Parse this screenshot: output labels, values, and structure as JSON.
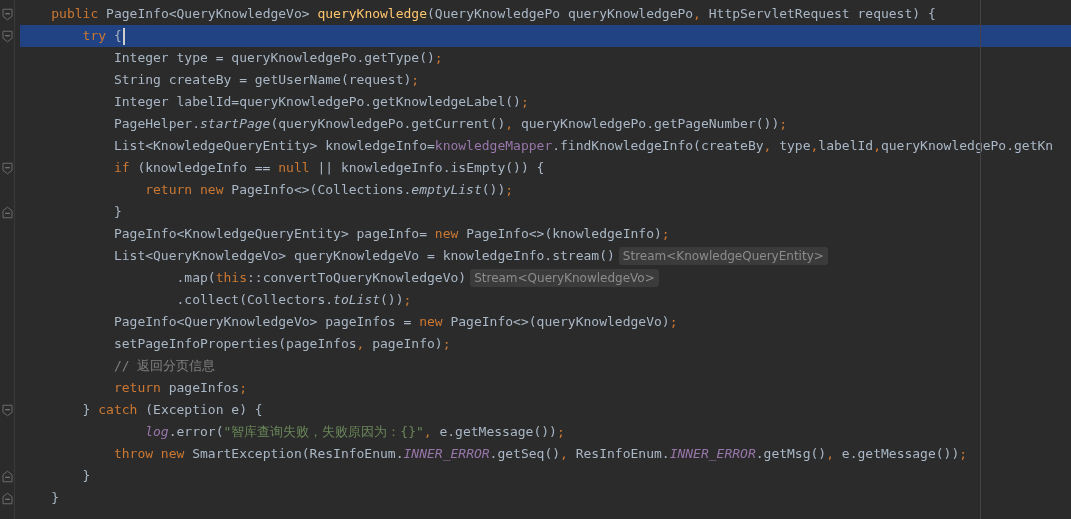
{
  "editor": {
    "lines": [
      {
        "selected": false,
        "fold_open": true,
        "tokens": [
          {
            "kind": "keyword",
            "text": "public "
          },
          {
            "kind": "plain",
            "text": "PageInfo<QueryKnowledgeVo> "
          },
          {
            "kind": "decl",
            "text": "queryKnowledge"
          },
          {
            "kind": "plain",
            "text": "(QueryKnowledgePo queryKnowledgePo"
          },
          {
            "kind": "punct",
            "text": ", "
          },
          {
            "kind": "plain",
            "text": "HttpServletRequest request) {"
          }
        ],
        "children": [
          {
            "selected": true,
            "fold_open": true,
            "tokens": [
              {
                "kind": "keyword",
                "text": "try "
              },
              {
                "kind": "plain",
                "text": "{"
              }
            ],
            "children": [
              {
                "selected": false,
                "tokens": [
                  {
                    "kind": "plain",
                    "text": "Integer type = queryKnowledgePo.getType()"
                  },
                  {
                    "kind": "punct",
                    "text": ";"
                  }
                ]
              },
              {
                "selected": false,
                "tokens": [
                  {
                    "kind": "plain",
                    "text": "String createBy = getUserName(request)"
                  },
                  {
                    "kind": "punct",
                    "text": ";"
                  }
                ]
              },
              {
                "selected": false,
                "tokens": [
                  {
                    "kind": "plain",
                    "text": "Integer labelId=queryKnowledgePo.getKnowledgeLabel()"
                  },
                  {
                    "kind": "punct",
                    "text": ";"
                  }
                ]
              },
              {
                "selected": false,
                "tokens": [
                  {
                    "kind": "plain",
                    "text": "PageHelper."
                  },
                  {
                    "kind": "static",
                    "text": "startPage"
                  },
                  {
                    "kind": "plain",
                    "text": "(queryKnowledgePo.getCurrent()"
                  },
                  {
                    "kind": "punct",
                    "text": ", "
                  },
                  {
                    "kind": "plain",
                    "text": "queryKnowledgePo.getPageNumber())"
                  },
                  {
                    "kind": "punct",
                    "text": ";"
                  }
                ]
              },
              {
                "selected": false,
                "tokens": [
                  {
                    "kind": "plain",
                    "text": "List<KnowledgeQueryEntity> knowledgeInfo="
                  },
                  {
                    "kind": "field",
                    "text": "knowledgeMapper"
                  },
                  {
                    "kind": "plain",
                    "text": ".findKnowledgeInfo(createBy"
                  },
                  {
                    "kind": "punct",
                    "text": ", "
                  },
                  {
                    "kind": "plain",
                    "text": "type"
                  },
                  {
                    "kind": "punct",
                    "text": ","
                  },
                  {
                    "kind": "plain",
                    "text": "labelId"
                  },
                  {
                    "kind": "punct",
                    "text": ","
                  },
                  {
                    "kind": "plain",
                    "text": "queryKnowledgePo.getKn"
                  }
                ]
              },
              {
                "selected": false,
                "fold_open": true,
                "tokens": [
                  {
                    "kind": "keyword",
                    "text": "if "
                  },
                  {
                    "kind": "plain",
                    "text": "(knowledgeInfo == "
                  },
                  {
                    "kind": "keyword",
                    "text": "null"
                  },
                  {
                    "kind": "plain",
                    "text": " || knowledgeInfo.isEmpty()) {"
                  }
                ],
                "children": [
                  {
                    "selected": false,
                    "tokens": [
                      {
                        "kind": "keyword",
                        "text": "return new "
                      },
                      {
                        "kind": "plain",
                        "text": "PageInfo<>(Collections."
                      },
                      {
                        "kind": "static",
                        "text": "emptyList"
                      },
                      {
                        "kind": "plain",
                        "text": "())"
                      },
                      {
                        "kind": "punct",
                        "text": ";"
                      }
                    ]
                  }
                ]
              },
              {
                "selected": false,
                "fold_close": true,
                "tokens": [
                  {
                    "kind": "plain",
                    "text": "}"
                  }
                ]
              },
              {
                "selected": false,
                "tokens": [
                  {
                    "kind": "plain",
                    "text": "PageInfo<KnowledgeQueryEntity> pageInfo= "
                  },
                  {
                    "kind": "keyword",
                    "text": "new "
                  },
                  {
                    "kind": "plain",
                    "text": "PageInfo<>(knowledgeInfo)"
                  },
                  {
                    "kind": "punct",
                    "text": ";"
                  }
                ]
              },
              {
                "selected": false,
                "hint": "Stream<KnowledgeQueryEntity>",
                "tokens": [
                  {
                    "kind": "plain",
                    "text": "List<QueryKnowledgeVo> queryKnowledgeVo = knowledgeInfo.stream()"
                  }
                ],
                "children": [
                  {
                    "selected": false,
                    "continuation": true,
                    "hint": "Stream<QueryKnowledgeVo>",
                    "tokens": [
                      {
                        "kind": "plain",
                        "text": ".map("
                      },
                      {
                        "kind": "keyword",
                        "text": "this"
                      },
                      {
                        "kind": "plain",
                        "text": "::convertToQueryKnowledgeVo)"
                      }
                    ]
                  },
                  {
                    "selected": false,
                    "continuation": true,
                    "tokens": [
                      {
                        "kind": "plain",
                        "text": ".collect(Collectors."
                      },
                      {
                        "kind": "static",
                        "text": "toList"
                      },
                      {
                        "kind": "plain",
                        "text": "())"
                      },
                      {
                        "kind": "punct",
                        "text": ";"
                      }
                    ]
                  }
                ]
              },
              {
                "selected": false,
                "tokens": [
                  {
                    "kind": "plain",
                    "text": "PageInfo<QueryKnowledgeVo> pageInfos = "
                  },
                  {
                    "kind": "keyword",
                    "text": "new "
                  },
                  {
                    "kind": "plain",
                    "text": "PageInfo<>(queryKnowledgeVo)"
                  },
                  {
                    "kind": "punct",
                    "text": ";"
                  }
                ]
              },
              {
                "selected": false,
                "tokens": [
                  {
                    "kind": "plain",
                    "text": "setPageInfoProperties(pageInfos"
                  },
                  {
                    "kind": "punct",
                    "text": ", "
                  },
                  {
                    "kind": "plain",
                    "text": "pageInfo)"
                  },
                  {
                    "kind": "punct",
                    "text": ";"
                  }
                ]
              },
              {
                "selected": false,
                "tokens": [
                  {
                    "kind": "comment",
                    "text": "// 返回分页信息"
                  }
                ]
              },
              {
                "selected": false,
                "tokens": [
                  {
                    "kind": "keyword",
                    "text": "return "
                  },
                  {
                    "kind": "plain",
                    "text": "pageInfos"
                  },
                  {
                    "kind": "punct",
                    "text": ";"
                  }
                ]
              }
            ]
          },
          {
            "selected": false,
            "fold_open": true,
            "tokens": [
              {
                "kind": "plain",
                "text": "} "
              },
              {
                "kind": "keyword",
                "text": "catch "
              },
              {
                "kind": "plain",
                "text": "(Exception e) {"
              }
            ],
            "children": [
              {
                "selected": false,
                "continuation": true,
                "tokens": [
                  {
                    "kind": "static_field",
                    "text": "log"
                  },
                  {
                    "kind": "plain",
                    "text": ".error("
                  },
                  {
                    "kind": "string",
                    "text": "\"智库查询失败，失败原因为：{}\""
                  },
                  {
                    "kind": "punct",
                    "text": ", "
                  },
                  {
                    "kind": "plain",
                    "text": "e.getMessage())"
                  },
                  {
                    "kind": "punct",
                    "text": ";"
                  }
                ]
              },
              {
                "selected": false,
                "tokens": [
                  {
                    "kind": "keyword",
                    "text": "throw new "
                  },
                  {
                    "kind": "plain",
                    "text": "SmartException(ResInfoEnum."
                  },
                  {
                    "kind": "static_field",
                    "text": "INNER_ERROR"
                  },
                  {
                    "kind": "plain",
                    "text": ".getSeq()"
                  },
                  {
                    "kind": "punct",
                    "text": ", "
                  },
                  {
                    "kind": "plain",
                    "text": "ResInfoEnum."
                  },
                  {
                    "kind": "static_field",
                    "text": "INNER_ERROR"
                  },
                  {
                    "kind": "plain",
                    "text": ".getMsg()"
                  },
                  {
                    "kind": "punct",
                    "text": ", "
                  },
                  {
                    "kind": "plain",
                    "text": "e.getMessage())"
                  },
                  {
                    "kind": "punct",
                    "text": ";"
                  }
                ]
              }
            ]
          },
          {
            "selected": false,
            "fold_close": true,
            "tokens": [
              {
                "kind": "plain",
                "text": "}"
              }
            ]
          }
        ]
      },
      {
        "selected": false,
        "fold_close": true,
        "tokens": [
          {
            "kind": "plain",
            "text": "}"
          }
        ]
      }
    ]
  }
}
